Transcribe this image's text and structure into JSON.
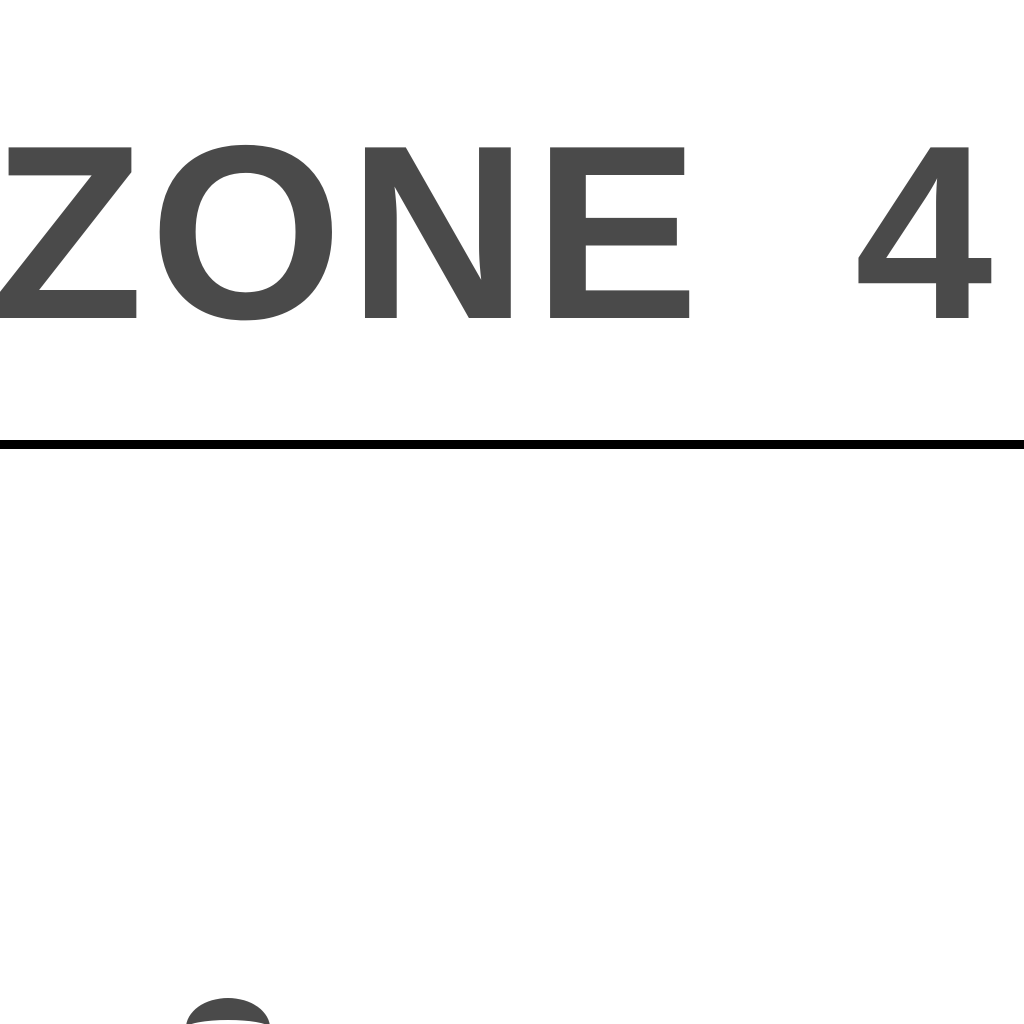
{
  "sign": {
    "zone_label": "ZONE  4"
  },
  "colors": {
    "text": "#4a4a4a",
    "divider": "#000000",
    "background": "#ffffff"
  }
}
